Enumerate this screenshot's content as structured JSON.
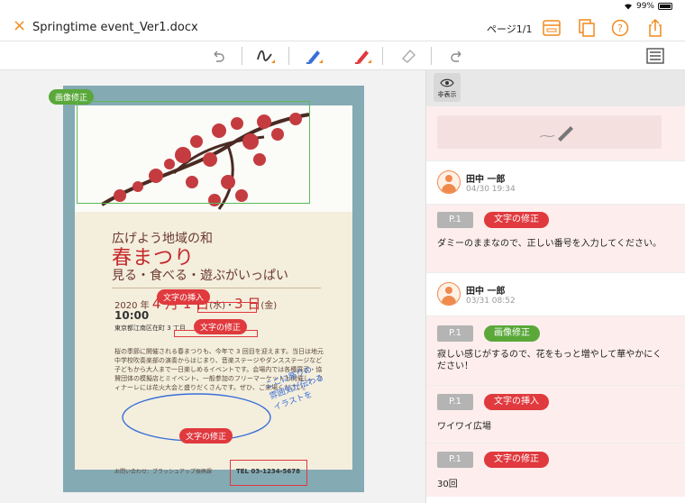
{
  "statusbar": {
    "battery": "99%"
  },
  "titlebar": {
    "close": "×",
    "title": "Springtime event_Ver1.docx",
    "page": "ページ1/1"
  },
  "colors": {
    "accent": "#f08a1c",
    "annotation_red": "#e0393e",
    "annotation_green": "#5aa83a",
    "frame": "#84aab4"
  },
  "toolbar": {
    "tools": [
      "undo-icon",
      "pen-icon",
      "highlighter-blue-icon",
      "highlighter-red-icon",
      "eraser-icon",
      "redo-icon",
      "list-icon"
    ]
  },
  "poster": {
    "line1": "広げよう地域の和",
    "line2": "春まつり",
    "line3": "見る・食べる・遊ぶがいっぱい",
    "date_prefix": "2020 年",
    "date_main1": "4 月 1 日",
    "date_mid": "(水)・",
    "date_main2": "3 日",
    "date_suffix": "(金)",
    "time": "10:00",
    "place": "東京都江南区在町 3 丁目",
    "body": "桜の季節に開催される春まつりも、今年で 3 回目を迎えます。当日は地元中学校吹奏楽部の演奏からはじまり、音楽ステージやダンスステージなど子どもから大人まで一日楽しめるイベントです。会場内では各種展示・協賛団体の模擬店とミイベント、一般参加のフリーマーケットも開催し、フィナーレには花火大会と盛りだくさんです。ぜひ、ご来場ください。",
    "contact": "お問い合わせ：ブラッシュアップ振興課",
    "tel": "TEL 03-1234-5678"
  },
  "annotations": {
    "image_fix": "画像修正",
    "text_insert": "文字の挿入",
    "text_fix1": "文字の修正",
    "text_fix2": "文字の修正",
    "handwriting": [
      "ここに祭りの",
      "雰囲気が伝わる",
      "イラストを"
    ]
  },
  "panel": {
    "hide_label": "非表示",
    "comments": [
      {
        "user": "田中 一郎",
        "date": "04/30 19:34",
        "page": "P.1",
        "kind": "文字の修正",
        "text": "ダミーのままなので、正しい番号を入力してください。"
      },
      {
        "user": "田中 一郎",
        "date": "03/31 08:52",
        "page": "P.1",
        "kind": "画像修正",
        "text": "寂しい感じがするので、花をもっと増やして華やかにください！"
      },
      {
        "page": "P.1",
        "kind": "文字の挿入",
        "text": "ワイワイ広場"
      },
      {
        "page": "P.1",
        "kind": "文字の修正",
        "text": "30回"
      }
    ]
  }
}
